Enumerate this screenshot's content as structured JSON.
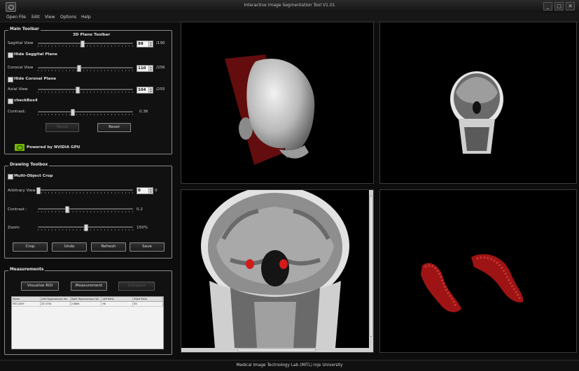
{
  "window": {
    "title": "Interactive Image Segmentation Tool V1.01",
    "minimize": "_",
    "maximize": "□",
    "close": "✕"
  },
  "menu": [
    "Open File",
    "Edit",
    "View",
    "Options",
    "Help"
  ],
  "main_toolbar": {
    "title": "Main Toolbar",
    "subtitle": "3D Plane Toolbar",
    "sagittal": {
      "label": "Sagittal View",
      "value": "88",
      "max": "/190",
      "level": 0.46
    },
    "hide_sagittal": "Hide Saggital Plane",
    "coronal": {
      "label": "Coronal View",
      "value": "110",
      "max": "/256",
      "level": 0.43
    },
    "hide_coronal": "Hide Coronal Plane",
    "axial": {
      "label": "Axial View",
      "value": "104",
      "max": "/255",
      "level": 0.41
    },
    "checkbox4": "checkBox4",
    "contrast": {
      "label": "Contrast:",
      "value": "0.36",
      "level": 0.36
    },
    "reset_left": "Reset",
    "reset": "Reset",
    "powered": "Powered by NVIDIA GPU"
  },
  "drawing_toolbox": {
    "title": "Drawing Toolbox",
    "multi_object": "Multi-Object Crop",
    "arbitrary": {
      "label": "Arbitrary View",
      "value": "0",
      "max": "0",
      "level": 0.0
    },
    "contrast": {
      "label": "Contrast :",
      "value": "0.2",
      "level": 0.3
    },
    "zoom": {
      "label": "Zoom:",
      "value": "150%",
      "level": 0.5
    },
    "buttons": [
      "Crop",
      "Undo",
      "Refresh",
      "Save"
    ]
  },
  "measurements": {
    "title": "Measurements",
    "buttons": [
      "Visualize ROI",
      "Measurement",
      "Compare"
    ],
    "table": {
      "headers": [
        "Name",
        "Left Hippocampus Vol.",
        "Right Hippocampus Vol.",
        "Left Ratio",
        "Right Ratio"
      ],
      "rows": [
        [
          "MITL2009",
          "2D 4734",
          "2.0664",
          "96",
          "63"
        ]
      ]
    }
  },
  "status": "Medical Image Technology Lab (MITL) Inje University"
}
